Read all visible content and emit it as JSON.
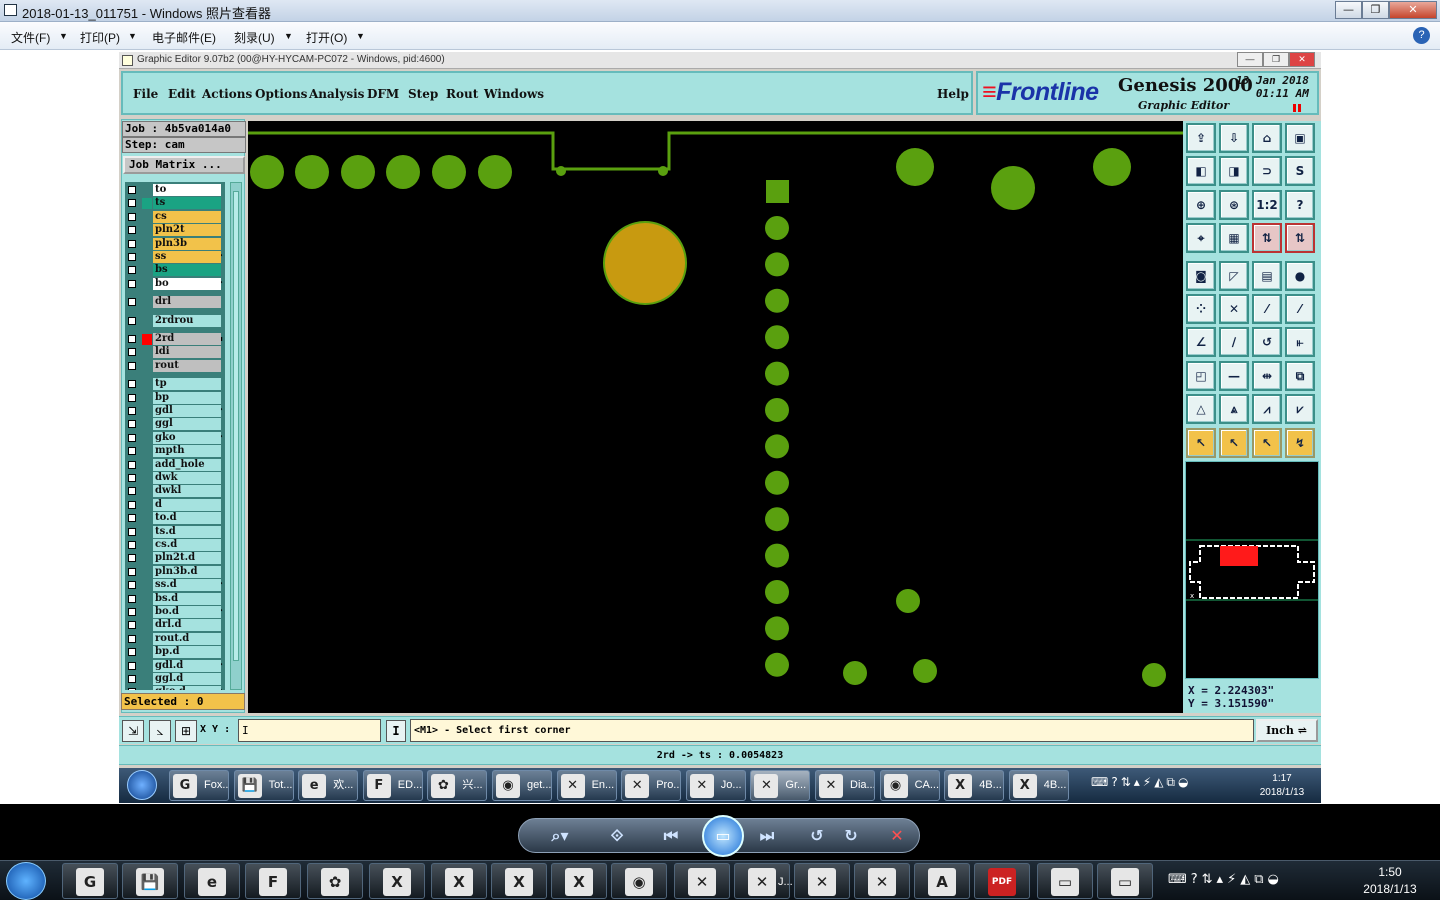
{
  "viewer": {
    "title": "2018-01-13_011751 - Windows 照片查看器",
    "menu": [
      "文件(F)",
      "打印(P)",
      "电子邮件(E)",
      "刻录(U)",
      "打开(O)"
    ],
    "help": "?"
  },
  "ge": {
    "title": "Graphic Editor 9.07b2 (00@HY-HYCAM-PC072 - Windows, pid:4600)",
    "menu": [
      "File",
      "Edit",
      "Actions",
      "Options",
      "Analysis",
      "DFM",
      "Step",
      "Rout",
      "Windows"
    ],
    "help_label": "Help",
    "logo": {
      "brand": "Frontline",
      "product": "Genesis 2000",
      "subtitle": "Graphic Editor",
      "date": "13 Jan 2018",
      "time": "01:11 AM"
    },
    "job": "Job : 4b5va014a0",
    "step": "Step: cam",
    "job_matrix": "Job Matrix ...",
    "selected": "Selected : 0",
    "xy_label": "X Y :",
    "xy_value": "I",
    "prompt": "<M1> - Select first corner",
    "units": "Inch",
    "status": "2rd -> ts : 0.0054823",
    "coord_x": "X = 2.224303\"",
    "coord_y": "Y = 3.151590\""
  },
  "layers": [
    {
      "name": "to",
      "color": "#ffffff"
    },
    {
      "name": "ts",
      "color": "#1aa383",
      "swatch": "#1aa383"
    },
    {
      "name": "cs",
      "color": "#f2c24a"
    },
    {
      "name": "pln2t",
      "color": "#f2c24a"
    },
    {
      "name": "pln3b",
      "color": "#f2c24a"
    },
    {
      "name": "ss",
      "color": "#f2c24a",
      "mark": "⬋"
    },
    {
      "name": "bs",
      "color": "#1aa383"
    },
    {
      "name": "bo",
      "color": "#ffffff",
      "mark": "⬋"
    },
    {
      "name": "drl",
      "color": "#bfbfbf"
    },
    {
      "name": "2rdrou",
      "color": "#a5e2df"
    },
    {
      "name": "2rd",
      "color": "#bfbfbf",
      "swatch": "#ff0000",
      "mark": "▪"
    },
    {
      "name": "ldi",
      "color": "#bfbfbf"
    },
    {
      "name": "rout",
      "color": "#bfbfbf"
    },
    {
      "name": "tp",
      "color": "#a5e2df"
    },
    {
      "name": "bp",
      "color": "#a5e2df"
    },
    {
      "name": "gdl",
      "color": "#a5e2df",
      "mark": "⬋"
    },
    {
      "name": "ggl",
      "color": "#a5e2df"
    },
    {
      "name": "gko",
      "color": "#a5e2df",
      "mark": "⬋"
    },
    {
      "name": "mpth",
      "color": "#a5e2df"
    },
    {
      "name": "add_hole",
      "color": "#a5e2df"
    },
    {
      "name": "dwk",
      "color": "#a5e2df"
    },
    {
      "name": "dwkl",
      "color": "#a5e2df"
    },
    {
      "name": "d",
      "color": "#a5e2df"
    },
    {
      "name": "to.d",
      "color": "#a5e2df"
    },
    {
      "name": "ts.d",
      "color": "#a5e2df"
    },
    {
      "name": "cs.d",
      "color": "#a5e2df"
    },
    {
      "name": "pln2t.d",
      "color": "#a5e2df"
    },
    {
      "name": "pln3b.d",
      "color": "#a5e2df"
    },
    {
      "name": "ss.d",
      "color": "#a5e2df",
      "mark": "⬋"
    },
    {
      "name": "bs.d",
      "color": "#a5e2df"
    },
    {
      "name": "bo.d",
      "color": "#a5e2df",
      "mark": "⬋"
    },
    {
      "name": "drl.d",
      "color": "#a5e2df"
    },
    {
      "name": "rout.d",
      "color": "#a5e2df"
    },
    {
      "name": "bp.d",
      "color": "#a5e2df"
    },
    {
      "name": "gdl.d",
      "color": "#a5e2df",
      "mark": "⬋"
    },
    {
      "name": "ggl.d",
      "color": "#a5e2df"
    },
    {
      "name": "gko.d",
      "color": "#a5e2df",
      "mark": "⬋"
    }
  ],
  "colors": {
    "pad": "#5aa00f",
    "selected_pad": "#c89a10",
    "panel": "#a5e2df",
    "canvas": "#000000"
  },
  "tools": [
    "⇪",
    "⇩",
    "⌂",
    "▣",
    "◧",
    "◨",
    "⊃",
    "S",
    "⊕",
    "⊛",
    "1:2",
    "?",
    "⌖",
    "▦",
    "⇅",
    "⇅",
    "◙",
    "◸",
    "▤",
    "●",
    "⁘",
    "✕",
    "⁄",
    "⁄",
    "∠",
    "∕",
    "↺",
    "⫦",
    "◰",
    "—",
    "⇹",
    "⧉",
    "△",
    "⩓",
    "⩘",
    "⩗",
    "↖",
    "↖",
    "↖",
    "↯"
  ],
  "inner_taskbar": [
    {
      "label": "Fox...",
      "icon": "G"
    },
    {
      "label": "Tot...",
      "icon": "💾"
    },
    {
      "label": "欢...",
      "icon": "e"
    },
    {
      "label": "ED...",
      "icon": "F"
    },
    {
      "label": "兴...",
      "icon": "✿"
    },
    {
      "label": "get...",
      "icon": "◉"
    },
    {
      "label": "En...",
      "icon": "✕"
    },
    {
      "label": "Pro...",
      "icon": "✕"
    },
    {
      "label": "Jo...",
      "icon": "✕"
    },
    {
      "label": "Gr...",
      "icon": "✕",
      "active": true
    },
    {
      "label": "Dia...",
      "icon": "✕"
    },
    {
      "label": "CA...",
      "icon": "◉"
    },
    {
      "label": "4B...",
      "icon": "X"
    },
    {
      "label": "4B...",
      "icon": "X"
    }
  ],
  "inner_clock": {
    "time": "1:17",
    "date": "2018/1/13"
  },
  "taskbar": [
    {
      "icon": "G"
    },
    {
      "icon": "💾"
    },
    {
      "icon": "e"
    },
    {
      "icon": "F"
    },
    {
      "icon": "✿"
    },
    {
      "icon": "X"
    },
    {
      "icon": "X"
    },
    {
      "icon": "X"
    },
    {
      "icon": "X"
    },
    {
      "icon": "◉"
    },
    {
      "icon": "✕"
    },
    {
      "icon": "✕",
      "label": "J..."
    },
    {
      "icon": "✕"
    },
    {
      "icon": "✕"
    },
    {
      "icon": "A"
    },
    {
      "icon": "PDF"
    },
    {
      "icon": "▭"
    },
    {
      "icon": "▭"
    }
  ],
  "clock": {
    "time": "1:50",
    "date": "2018/1/13"
  }
}
